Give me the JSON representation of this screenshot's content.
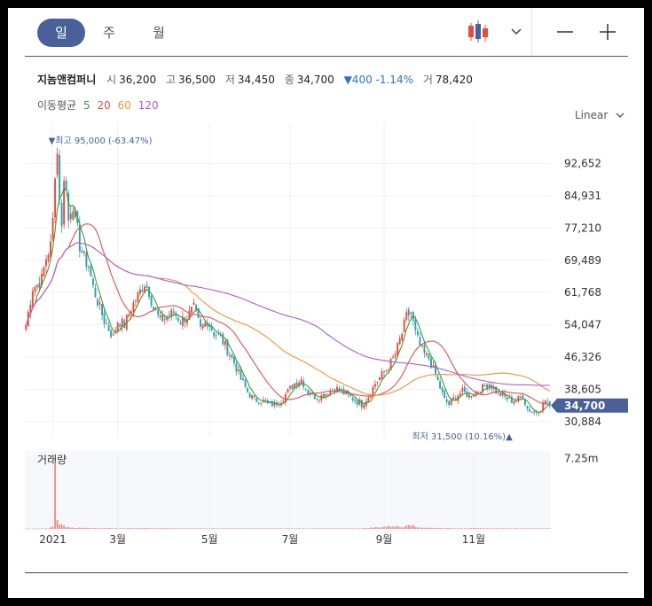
{
  "tabs": [
    {
      "label": "일",
      "active": true
    },
    {
      "label": "주",
      "active": false
    },
    {
      "label": "월",
      "active": false
    }
  ],
  "toolbar": {
    "chart_type_icon": "candlestick-icon",
    "dropdown_icon": "chevron-down-icon",
    "zoom_out_icon": "minus-icon",
    "zoom_in_icon": "plus-icon",
    "scale_label": "Linear",
    "scale_icon": "chevron-down-icon"
  },
  "quote": {
    "name": "지놈앤컴퍼니",
    "open_label": "시",
    "open": "36,200",
    "high_label": "고",
    "high": "36,500",
    "low_label": "저",
    "low": "34,450",
    "close_label": "종",
    "close": "34,700",
    "change": "▼400 -1.14%",
    "volume_label": "거",
    "volume": "78,420"
  },
  "ma": {
    "label": "이동평균",
    "periods": [
      {
        "label": "5",
        "color": "#3f9c3f"
      },
      {
        "label": "20",
        "color": "#e05050"
      },
      {
        "label": "60",
        "color": "#f0923a"
      },
      {
        "label": "120",
        "color": "#a661d6"
      }
    ]
  },
  "colors": {
    "up": "#e74c3c",
    "down": "#2f9fb0",
    "accent": "#4a6098",
    "ma5": "#3f9c3f",
    "ma20": "#e05050",
    "ma60": "#f0923a",
    "ma120": "#a661d6",
    "volume": "#f08a80"
  },
  "chart_data": {
    "type": "candlestick",
    "price_ticks": [
      "92,652",
      "84,931",
      "77,210",
      "69,489",
      "61,768",
      "54,047",
      "46,326",
      "38,605",
      "30,884"
    ],
    "price_tick_values": [
      92652,
      84931,
      77210,
      69489,
      61768,
      54047,
      46326,
      38605,
      30884
    ],
    "ylim": [
      28500,
      98500
    ],
    "x_ticks": [
      "2021",
      "3월",
      "5월",
      "7월",
      "9월",
      "11월"
    ],
    "x_tick_sessions": [
      12,
      41,
      82,
      118,
      160,
      200
    ],
    "sessions": 235,
    "last_price": 34700,
    "last_price_label": "34,700",
    "high_marker": {
      "label": "▼최고 95,000 (-63.47%)",
      "session": 14
    },
    "low_marker": {
      "label": "최저 31,500 (10.16%)▲",
      "session": 215
    },
    "volume_label": "거래량",
    "volume_tick": "7.25m",
    "volume_tick_value": 7250000,
    "volume_max": 8000000,
    "price_anchors": [
      [
        0,
        54000
      ],
      [
        1,
        57000
      ],
      [
        3,
        63000
      ],
      [
        5,
        63500
      ],
      [
        7,
        65000
      ],
      [
        9,
        70000
      ],
      [
        11,
        73000
      ],
      [
        12,
        79000
      ],
      [
        13,
        91000
      ],
      [
        14,
        95000
      ],
      [
        15,
        85000
      ],
      [
        16,
        77000
      ],
      [
        17,
        90000
      ],
      [
        18,
        86000
      ],
      [
        19,
        79000
      ],
      [
        20,
        82000
      ],
      [
        22,
        80000
      ],
      [
        24,
        73000
      ],
      [
        26,
        70000
      ],
      [
        28,
        68000
      ],
      [
        30,
        63000
      ],
      [
        33,
        58000
      ],
      [
        35,
        55000
      ],
      [
        37,
        53000
      ],
      [
        39,
        51000
      ],
      [
        41,
        55000
      ],
      [
        44,
        54000
      ],
      [
        47,
        58000
      ],
      [
        50,
        61000
      ],
      [
        53,
        64000
      ],
      [
        55,
        62000
      ],
      [
        57,
        58000
      ],
      [
        60,
        55000
      ],
      [
        63,
        56000
      ],
      [
        66,
        57000
      ],
      [
        69,
        55000
      ],
      [
        72,
        56000
      ],
      [
        75,
        58000
      ],
      [
        78,
        53000
      ],
      [
        81,
        55000
      ],
      [
        84,
        52000
      ],
      [
        87,
        51000
      ],
      [
        90,
        48000
      ],
      [
        93,
        45000
      ],
      [
        96,
        41000
      ],
      [
        99,
        38000
      ],
      [
        102,
        36000
      ],
      [
        105,
        36000
      ],
      [
        108,
        35000
      ],
      [
        111,
        35000
      ],
      [
        114,
        36000
      ],
      [
        117,
        38000
      ],
      [
        120,
        40000
      ],
      [
        123,
        41000
      ],
      [
        126,
        38000
      ],
      [
        129,
        37000
      ],
      [
        132,
        37000
      ],
      [
        135,
        38000
      ],
      [
        138,
        39000
      ],
      [
        141,
        38000
      ],
      [
        144,
        37000
      ],
      [
        147,
        36000
      ],
      [
        150,
        35000
      ],
      [
        153,
        37000
      ],
      [
        156,
        40000
      ],
      [
        159,
        42000
      ],
      [
        162,
        44000
      ],
      [
        165,
        47000
      ],
      [
        168,
        52000
      ],
      [
        170,
        56000
      ],
      [
        172,
        57000
      ],
      [
        174,
        52000
      ],
      [
        176,
        49000
      ],
      [
        178,
        47000
      ],
      [
        180,
        46000
      ],
      [
        183,
        42000
      ],
      [
        185,
        39000
      ],
      [
        187,
        36000
      ],
      [
        189,
        35000
      ],
      [
        192,
        37000
      ],
      [
        195,
        38000
      ],
      [
        198,
        37000
      ],
      [
        201,
        38000
      ],
      [
        204,
        39000
      ],
      [
        207,
        40000
      ],
      [
        210,
        38000
      ],
      [
        213,
        37000
      ],
      [
        216,
        36000
      ],
      [
        219,
        36000
      ],
      [
        222,
        37000
      ],
      [
        224,
        34000
      ],
      [
        227,
        33000
      ],
      [
        230,
        34000
      ],
      [
        232,
        36000
      ],
      [
        234,
        35000
      ]
    ],
    "volume_anchors": [
      [
        0,
        0.03
      ],
      [
        10,
        0.05
      ],
      [
        12,
        0.2
      ],
      [
        13,
        7.25
      ],
      [
        14,
        0.9
      ],
      [
        15,
        0.5
      ],
      [
        16,
        0.4
      ],
      [
        17,
        0.35
      ],
      [
        18,
        0.2
      ],
      [
        20,
        0.15
      ],
      [
        25,
        0.1
      ],
      [
        30,
        0.08
      ],
      [
        45,
        0.07
      ],
      [
        60,
        0.06
      ],
      [
        80,
        0.05
      ],
      [
        100,
        0.05
      ],
      [
        120,
        0.05
      ],
      [
        150,
        0.05
      ],
      [
        165,
        0.3
      ],
      [
        168,
        0.15
      ],
      [
        171,
        0.55
      ],
      [
        174,
        0.2
      ],
      [
        178,
        0.12
      ],
      [
        190,
        0.07
      ],
      [
        210,
        0.06
      ],
      [
        234,
        0.05
      ]
    ]
  }
}
